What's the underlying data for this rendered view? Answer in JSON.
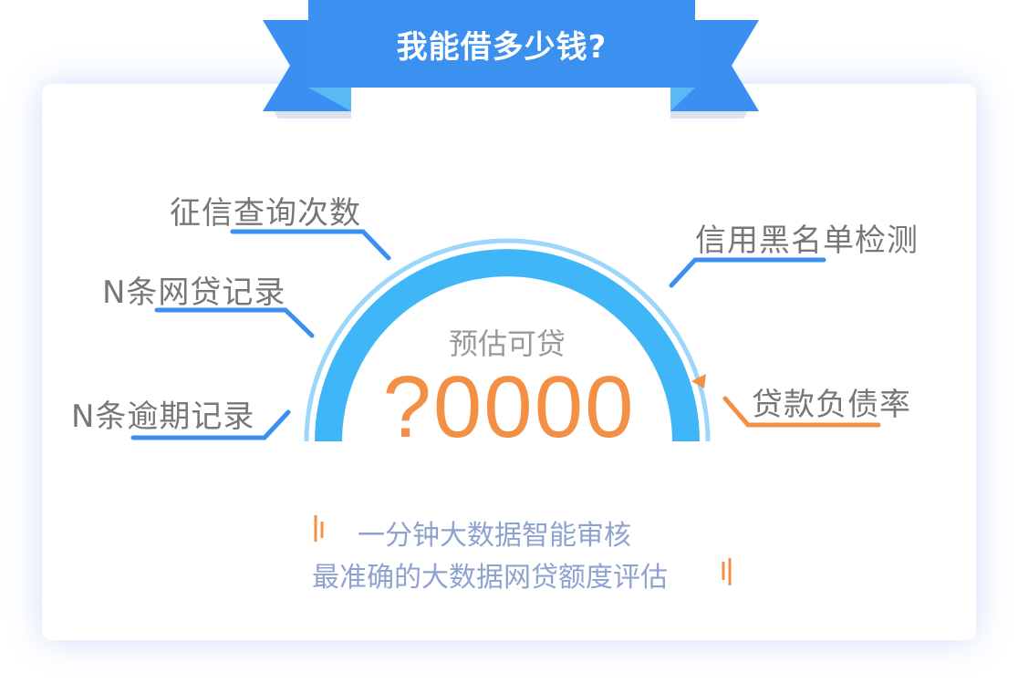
{
  "banner": {
    "title": "我能借多少钱?"
  },
  "gauge": {
    "caption": "预估可贷",
    "amount": "?0000"
  },
  "factors": {
    "top_left": "征信查询次数",
    "mid_left": "N条网贷记录",
    "bottom_left": "N条逾期记录",
    "top_right": "信用黑名单检测",
    "bottom_right": "贷款负债率"
  },
  "taglines": {
    "line1": "一分钟大数据智能审核",
    "line2": "最准确的大数据网贷额度评估"
  },
  "colors": {
    "ribbon_blue": "#3b8ff0",
    "ribbon_light": "#59b9f5",
    "gauge_blue": "#3fb6f8",
    "gauge_ring": "#9ad7fb",
    "connector_blue": "#3a8ff0",
    "accent_orange": "#f39045",
    "tagline_gray_blue": "#8ea2cf"
  }
}
